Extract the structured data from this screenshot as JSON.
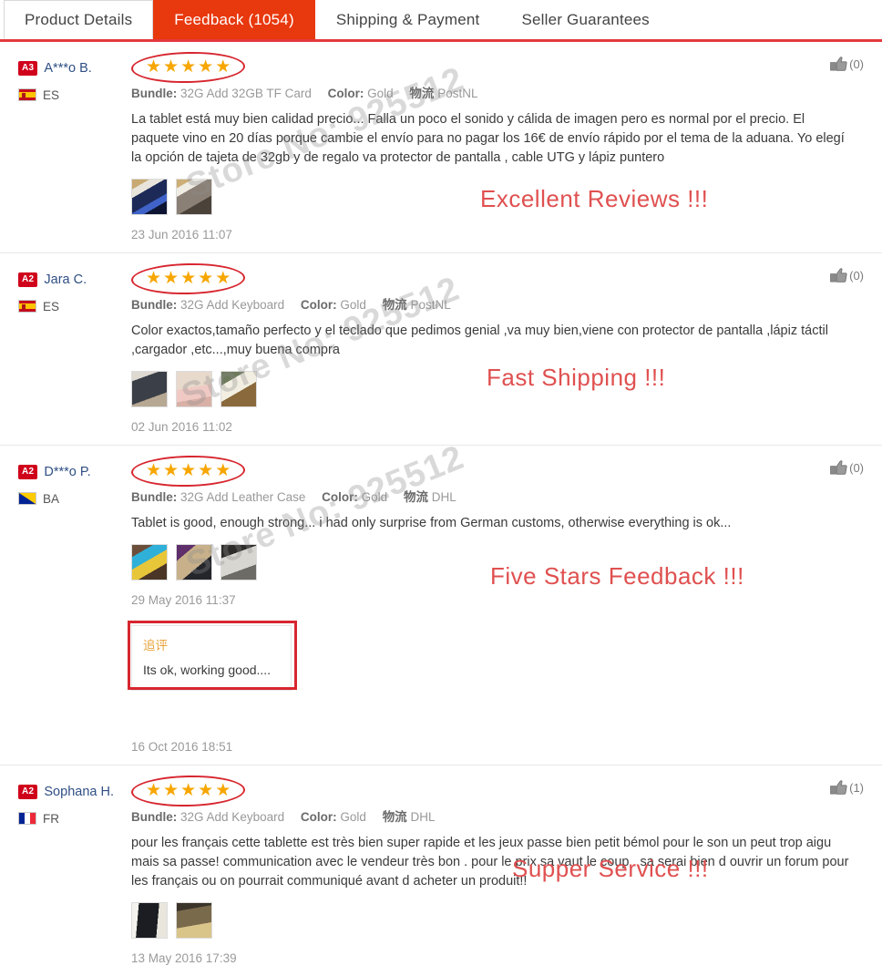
{
  "tabs": [
    {
      "label": "Product Details",
      "active": false
    },
    {
      "label": "Feedback (1054)",
      "active": true
    },
    {
      "label": "Shipping & Payment",
      "active": false
    },
    {
      "label": "Seller Guarantees",
      "active": false
    }
  ],
  "labels": {
    "bundle": "Bundle:",
    "color": "Color:",
    "logistics": "物流",
    "followup_title": "追评"
  },
  "reviews": [
    {
      "level": "A3",
      "username": "A***o B.",
      "country_code": "ES",
      "country": "es",
      "stars": 5,
      "bundle": "32G Add 32GB TF Card",
      "color": "Gold",
      "shipping": "PostNL",
      "text": "La tablet está muy bien calidad precio... Falla un poco el sonido y cálida de imagen pero es normal por el precio. El paquete vino en 20 días porque cambie el envío para no pagar los 16€ de envío rápido por el tema de la aduana. Yo elegí la opción de tajeta de 32gb y de regalo va protector de pantalla , cable UTG y lápiz puntero",
      "date": "23 Jun 2016 11:07",
      "likes": "(0)",
      "thumbs": 2,
      "followup": null
    },
    {
      "level": "A2",
      "username": "Jara C.",
      "country_code": "ES",
      "country": "es",
      "stars": 5,
      "bundle": "32G Add Keyboard",
      "color": "Gold",
      "shipping": "PostNL",
      "text": "Color exactos,tamaño perfecto y el teclado que pedimos genial ,va muy bien,viene con protector de pantalla ,lápiz táctil ,cargador ,etc...,muy buena compra",
      "date": "02 Jun 2016 11:02",
      "likes": "(0)",
      "thumbs": 3,
      "followup": null
    },
    {
      "level": "A2",
      "username": "D***o P.",
      "country_code": "BA",
      "country": "ba",
      "stars": 5,
      "bundle": "32G Add Leather Case",
      "color": "Gold",
      "shipping": "DHL",
      "text": "Tablet is good, enough strong... i had only surprise from German customs, otherwise everything is ok...",
      "date": "29 May 2016 11:37",
      "likes": "(0)",
      "thumbs": 3,
      "followup": {
        "text": "Its ok, working good....",
        "date": "16 Oct 2016 18:51"
      }
    },
    {
      "level": "A2",
      "username": "Sophana H.",
      "country_code": "FR",
      "country": "fr",
      "stars": 5,
      "bundle": "32G Add Keyboard",
      "color": "Gold",
      "shipping": "DHL",
      "text": "pour les français cette tablette est très bien super rapide et les jeux passe bien petit bémol pour le son un peut trop aigu mais sa passe! communication avec le vendeur très bon . pour le prix sa vaut le coup . sa serai bien d ouvrir un forum pour les français ou on pourrait communiqué avant d acheter un produit!!",
      "date": "13 May 2016 17:39",
      "likes": "(1)",
      "thumbs": 2,
      "followup": null
    }
  ],
  "annotations": [
    {
      "text": "Excellent Reviews !!!"
    },
    {
      "text": "Fast Shipping !!!"
    },
    {
      "text": "Five Stars Feedback !!!"
    },
    {
      "text": "Supper Service !!!"
    }
  ],
  "watermark": "Store No: 925512",
  "colors": {
    "tab_active_bg": "#e8380d",
    "tab_underline": "#e4393c",
    "star": "#f7a600",
    "annotation": "#e05050",
    "annotation_outline": "#d7262f",
    "username": "#2f4f84",
    "followup_title": "#e8a33d",
    "level_badge": "#d0021b"
  }
}
